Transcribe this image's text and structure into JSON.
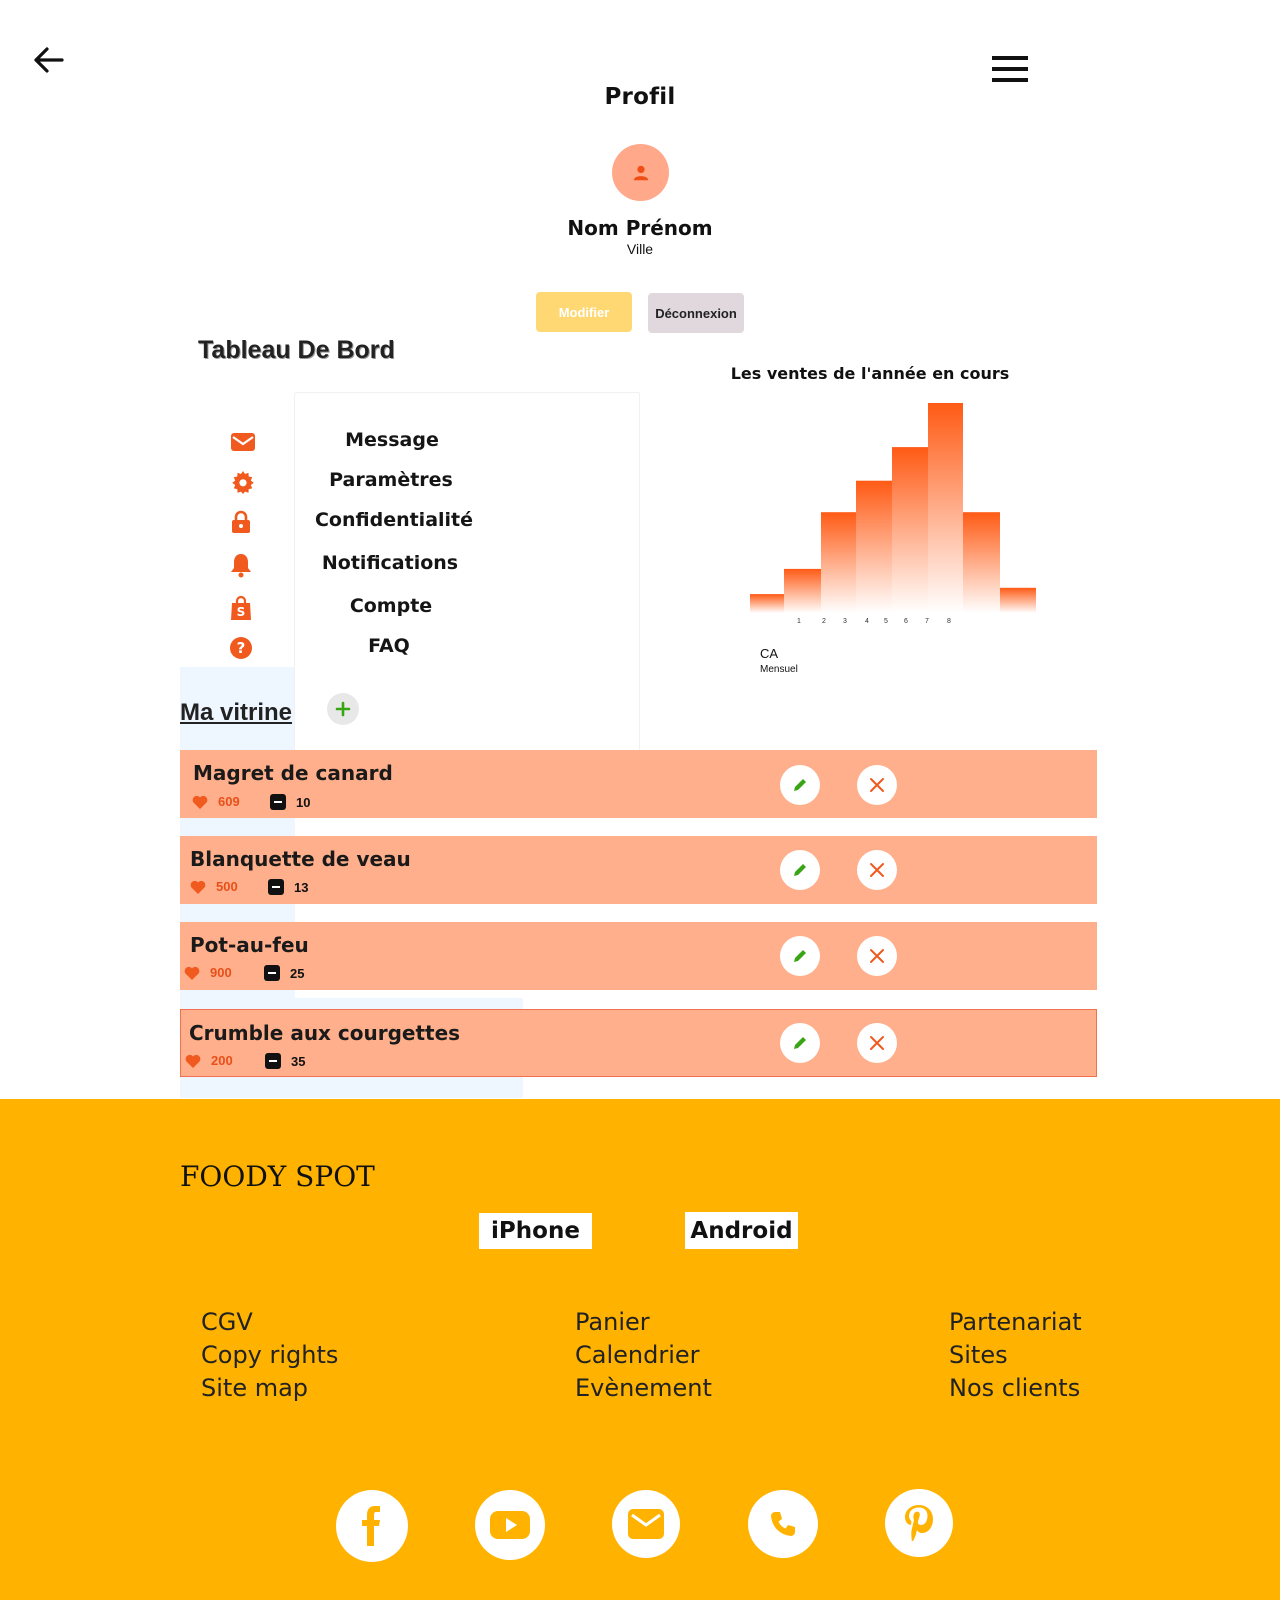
{
  "header": {
    "back_icon": "arrow-left-icon",
    "menu_icon": "hamburger-menu-icon",
    "title": "Profil"
  },
  "profile": {
    "avatar_icon": "user-icon",
    "name": "Nom Prénom",
    "city": "Ville",
    "edit_label": "Modifier",
    "logout_label": "Déconnexion"
  },
  "dashboard": {
    "title": "Tableau De Bord",
    "menu": [
      {
        "label": "Message",
        "icon": "envelope-icon"
      },
      {
        "label": "Paramètres",
        "icon": "gear-icon"
      },
      {
        "label": "Confidentialité",
        "icon": "lock-icon"
      },
      {
        "label": "Notifications",
        "icon": "bell-icon"
      },
      {
        "label": "Compte",
        "icon": "shopping-bag-icon"
      },
      {
        "label": "FAQ",
        "icon": "question-icon"
      }
    ]
  },
  "chart_data": {
    "type": "bar",
    "title": "Les ventes de l'année en cours",
    "categories": [
      "",
      "1",
      "2",
      "3",
      "4",
      "5",
      "6",
      "7",
      "8",
      ""
    ],
    "values": [
      9,
      21,
      48,
      63,
      79,
      100,
      48,
      12
    ],
    "ylabel": "CA",
    "subtitle": "Mensuel",
    "grid": false,
    "legend": "none",
    "colors": {
      "top": "#ff5a14",
      "bottom": "#ffffff"
    }
  },
  "vitrine": {
    "title": "Ma vitrine",
    "add_icon": "plus-icon",
    "products": [
      {
        "name": "Magret de canard",
        "likes": "609",
        "qty": "10"
      },
      {
        "name": "Blanquette de veau",
        "likes": "500",
        "qty": "13"
      },
      {
        "name": "Pot-au-feu",
        "likes": "900",
        "qty": "25"
      },
      {
        "name": "Crumble aux courgettes",
        "likes": "200",
        "qty": "35"
      }
    ],
    "edit_icon": "pencil-icon",
    "delete_icon": "close-icon"
  },
  "footer": {
    "brand": "FOODY SPOT",
    "iphone_label": "iPhone",
    "android_label": "Android",
    "col1": [
      "CGV",
      "Copy rights",
      "Site map"
    ],
    "col2": [
      "Panier",
      "Calendrier",
      "Evènement"
    ],
    "col3": [
      "Partenariat",
      "Sites",
      "Nos clients"
    ],
    "social": [
      "facebook-icon",
      "youtube-icon",
      "mail-icon",
      "phone-icon",
      "pinterest-icon"
    ],
    "background": "#ffb300"
  },
  "colors": {
    "accent": "#f05a1e",
    "row_bg": "#ffaf8b",
    "edit_green": "#3aa514"
  }
}
